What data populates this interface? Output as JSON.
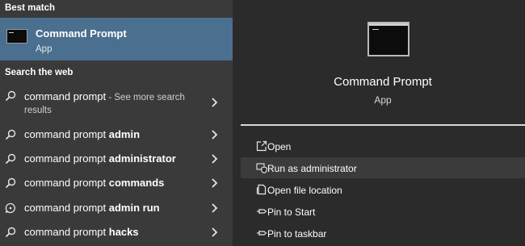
{
  "left": {
    "best_match_header": "Best match",
    "best_match": {
      "name": "Command Prompt",
      "type": "App",
      "icon": "command-prompt-icon"
    },
    "search_web_header": "Search the web",
    "web_results": [
      {
        "prefix": "command prompt",
        "bold": "",
        "suffix": " - See more search",
        "line2": "results"
      },
      {
        "prefix": "command prompt ",
        "bold": "admin",
        "suffix": "",
        "line2": ""
      },
      {
        "prefix": "command prompt ",
        "bold": "administrator",
        "suffix": "",
        "line2": ""
      },
      {
        "prefix": "command prompt ",
        "bold": "commands",
        "suffix": "",
        "line2": ""
      },
      {
        "prefix": "command prompt ",
        "bold": "admin run",
        "suffix": "",
        "line2": ""
      },
      {
        "prefix": "command prompt ",
        "bold": "hacks",
        "suffix": "",
        "line2": ""
      }
    ]
  },
  "right": {
    "title": "Command Prompt",
    "subtitle": "App",
    "actions": [
      {
        "label": "Open",
        "icon": "open-icon"
      },
      {
        "label": "Run as administrator",
        "icon": "shield-icon"
      },
      {
        "label": "Open file location",
        "icon": "file-location-icon"
      },
      {
        "label": "Pin to Start",
        "icon": "pin-icon"
      },
      {
        "label": "Pin to taskbar",
        "icon": "pin-icon"
      }
    ]
  },
  "colors": {
    "best_match_bg": "#4a6f8f",
    "left_bg": "#3a3a3a",
    "right_bg": "#2b2b2b",
    "hover_bg": "#3b3b3b"
  }
}
